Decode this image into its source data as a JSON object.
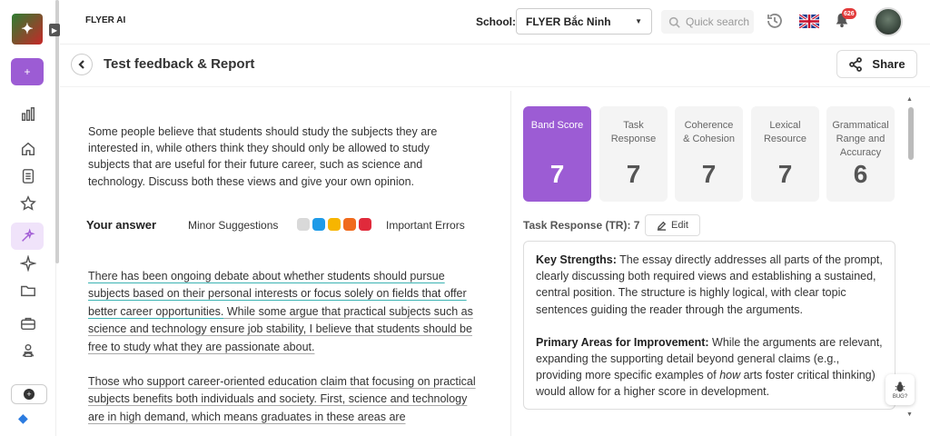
{
  "app": {
    "brand": "FLYER AI"
  },
  "topbar": {
    "school_label": "School:",
    "school_value": "FLYER Bắc Ninh",
    "search_placeholder": "Quick search",
    "notification_count": "626"
  },
  "header": {
    "title": "Test feedback & Report",
    "share_label": "Share"
  },
  "sidebar": {
    "add_label": "+",
    "items": [
      "chart-icon",
      "home-icon",
      "document-icon",
      "star-icon",
      "sparkle-tool-icon",
      "sparkle-icon",
      "folder-icon",
      "briefcase-icon",
      "users-icon"
    ]
  },
  "prompt": "Some people believe that students should study the subjects they are interested in, while others think they should only be allowed to study subjects that are useful for their future career, such as science and technology. Discuss both these views and give your own opinion.",
  "answer_section": {
    "title": "Your answer",
    "minor_label": "Minor Suggestions",
    "important_label": "Important Errors",
    "legend_colors": [
      "#d9d9d9",
      "#1e9be8",
      "#f7b500",
      "#f06a1c",
      "#e02a3b"
    ]
  },
  "essay": {
    "p1_underlined": "There has been ongoing debate about whether students should pursue subjects based on their personal interests or focus solely on fields that offer better career opportunities.",
    "p1_rest_a": " While some argue that practical subjects such as science and technology ensure job stability, I believe that students should be free to study what they are passionate about.",
    "p2": "Those who support career-oriented education claim that focusing on practical subjects benefits both individuals and society. First, science and technology are in high demand, which means graduates in these areas are"
  },
  "scores": [
    {
      "label": "Band Score",
      "value": "7"
    },
    {
      "label": "Task Response",
      "value": "7"
    },
    {
      "label": "Coherence & Cohesion",
      "value": "7"
    },
    {
      "label": "Lexical Resource",
      "value": "7"
    },
    {
      "label": "Grammatical Range and Accuracy",
      "value": "6"
    }
  ],
  "task_response": {
    "label": "Task Response (TR): 7",
    "edit_label": "Edit",
    "strengths_title": "Key Strengths:",
    "strengths_text": " The essay directly addresses all parts of the prompt, clearly discussing both required views and establishing a sustained, central position. The structure is highly logical, with clear topic sentences guiding the reader through the arguments.",
    "improve_title": "Primary Areas for Improvement:",
    "improve_text_a": " While the arguments are relevant, expanding the supporting detail beyond general claims (e.g., providing more specific examples of ",
    "improve_em": "how",
    "improve_text_b": " arts foster critical thinking) would allow for a higher score in development."
  },
  "bug_label": "BUG?",
  "colors": {
    "accent": "#9c5cd4",
    "accent_light": "#f0e3fa"
  }
}
